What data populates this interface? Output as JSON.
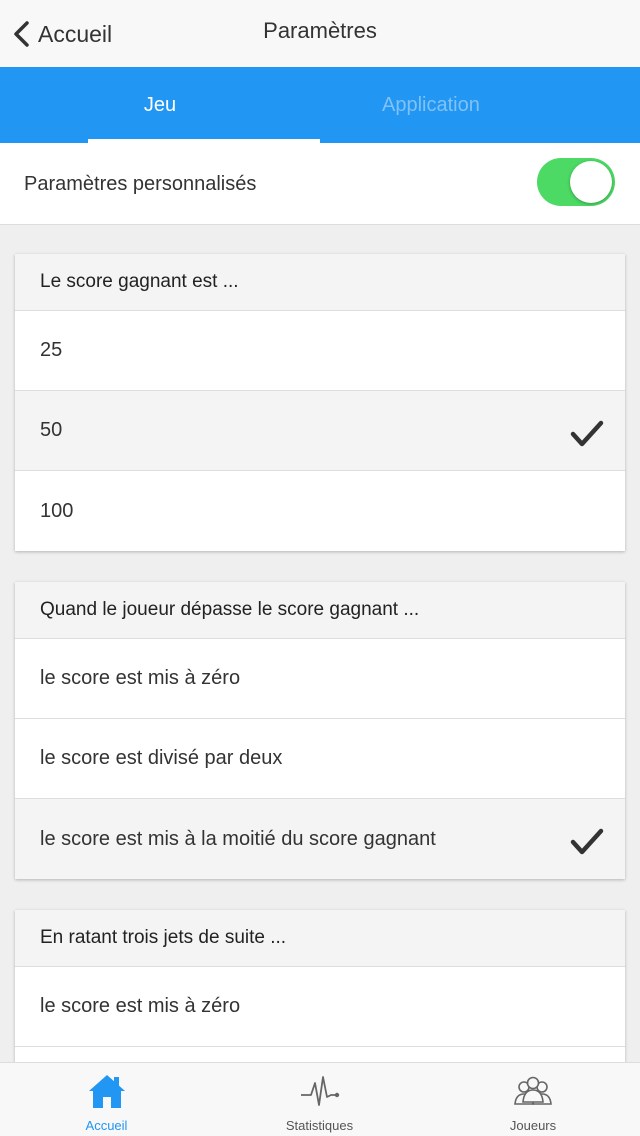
{
  "header": {
    "back_label": "Accueil",
    "title": "Paramètres"
  },
  "tabs": [
    {
      "label": "Jeu",
      "active": true
    },
    {
      "label": "Application",
      "active": false
    }
  ],
  "custom_settings": {
    "label": "Paramètres personnalisés",
    "enabled": true
  },
  "sections": [
    {
      "title": "Le score gagnant est ...",
      "options": [
        {
          "label": "25",
          "selected": false
        },
        {
          "label": "50",
          "selected": true
        },
        {
          "label": "100",
          "selected": false
        }
      ]
    },
    {
      "title": "Quand le joueur dépasse le score gagnant ...",
      "options": [
        {
          "label": "le score est mis à zéro",
          "selected": false
        },
        {
          "label": "le score est divisé par deux",
          "selected": false
        },
        {
          "label": "le score est mis à la moitié du score gagnant",
          "selected": true
        }
      ]
    },
    {
      "title": "En ratant trois jets de suite ...",
      "options": [
        {
          "label": "le score est mis à zéro",
          "selected": false
        }
      ]
    }
  ],
  "bottom_nav": [
    {
      "label": "Accueil",
      "icon": "home-icon",
      "active": true
    },
    {
      "label": "Statistiques",
      "icon": "pulse-icon",
      "active": false
    },
    {
      "label": "Joueurs",
      "icon": "players-icon",
      "active": false
    }
  ],
  "colors": {
    "accent": "#2196f3",
    "toggle_on": "#4cd964"
  }
}
